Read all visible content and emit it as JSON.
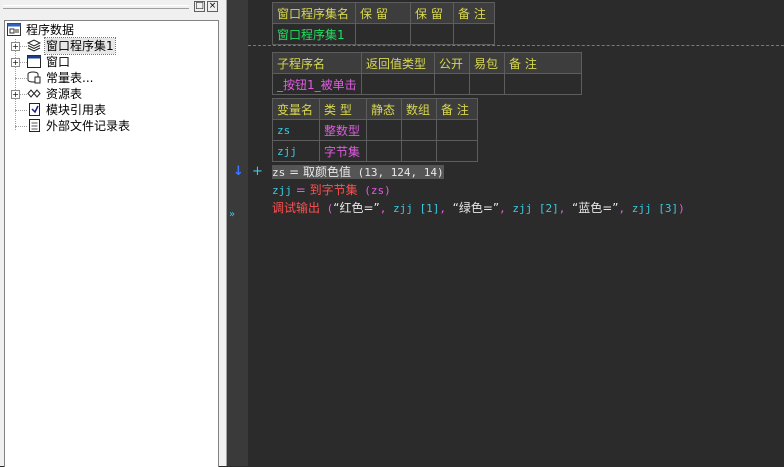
{
  "tree": {
    "root": "程序数据",
    "items": [
      {
        "label": "窗口程序集1",
        "expandable": true,
        "icon": "stack-icon"
      },
      {
        "label": "窗口",
        "expandable": true,
        "icon": "window-icon"
      },
      {
        "label": "常量表...",
        "expandable": false,
        "icon": "constant-table-icon"
      },
      {
        "label": "资源表",
        "expandable": true,
        "icon": "resource-icon"
      },
      {
        "label": "模块引用表",
        "expandable": false,
        "icon": "module-ref-icon"
      },
      {
        "label": "外部文件记录表",
        "expandable": false,
        "icon": "external-file-icon"
      }
    ],
    "pin_glyph": "□",
    "close_glyph": "×"
  },
  "assembly_table": {
    "headers": [
      "窗口程序集名",
      "保 留",
      "保 留",
      "备 注"
    ],
    "row": [
      "窗口程序集1",
      "",
      "",
      ""
    ]
  },
  "sub_table": {
    "headers": [
      "子程序名",
      "返回值类型",
      "公开",
      "易包",
      "备 注"
    ],
    "row": [
      "_按钮1_被单击",
      "",
      "",
      "",
      ""
    ]
  },
  "var_table": {
    "headers": [
      "变量名",
      "类 型",
      "静态",
      "数组",
      "备 注"
    ],
    "rows": [
      [
        "zs",
        "整数型",
        "",
        "",
        ""
      ],
      [
        "zjj",
        "字节集",
        "",
        "",
        ""
      ]
    ]
  },
  "code": {
    "line1": {
      "var": "zs",
      "op": " = ",
      "func": "取颜色值",
      "args": " (13, 124, 14)"
    },
    "line2": {
      "var": "zjj",
      "op": " = ",
      "func": "到字节集",
      "args": " (zs)"
    },
    "line3": {
      "func": "调试输出",
      "open": " (",
      "s1": "“红色=”",
      "sep1": ", ",
      "a1": "zjj [1]",
      "sep2": ", ",
      "s2": "“绿色=”",
      "sep3": ", ",
      "a2": "zjj [2]",
      "sep4": ", ",
      "s3": "“蓝色=”",
      "sep5": ", ",
      "a3": "zjj [3]",
      "close": ")"
    }
  },
  "gutter": {
    "arrow_glyph": "↓",
    "plus_glyph": "+",
    "run_glyph": "»"
  },
  "colors": {
    "background": "#2b2b2b",
    "header_text": "#d8d850",
    "divider": "#22b622",
    "identifier": "#3cc8e0",
    "type_name": "#e05ce0",
    "function_call": "#ff5050"
  }
}
